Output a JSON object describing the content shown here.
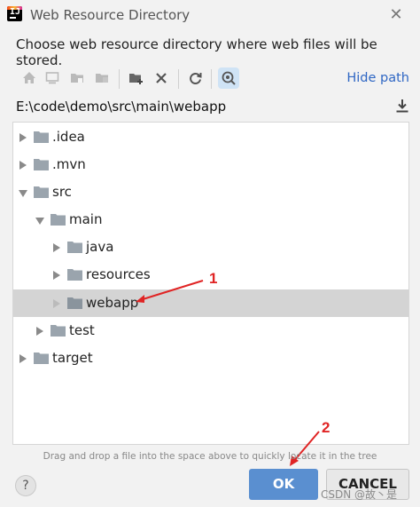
{
  "window": {
    "title": "Web Resource Directory",
    "app_icon": "intellij-idea-icon",
    "close_icon": "close-icon"
  },
  "prompt": "Choose web resource directory where web files will be stored.",
  "toolbar": {
    "buttons": [
      {
        "icon": "home-icon",
        "enabled": false
      },
      {
        "icon": "desktop-icon",
        "enabled": false
      },
      {
        "icon": "project-folder-icon",
        "enabled": false
      },
      {
        "icon": "module-folder-icon",
        "enabled": false
      },
      {
        "icon": "new-folder-icon",
        "enabled": true
      },
      {
        "icon": "delete-icon",
        "enabled": true
      },
      {
        "icon": "refresh-icon",
        "enabled": true
      },
      {
        "icon": "show-hidden-files-icon",
        "enabled": true,
        "active": true
      }
    ],
    "hide_path": "Hide path"
  },
  "path": {
    "value": "E:\\code\\demo\\src\\main\\webapp",
    "download_icon": "download-icon"
  },
  "tree": [
    {
      "label": ".idea",
      "expanded": false
    },
    {
      "label": ".mvn",
      "expanded": false
    },
    {
      "label": "src",
      "expanded": true
    },
    {
      "label": "main",
      "expanded": true
    },
    {
      "label": "java",
      "expanded": false
    },
    {
      "label": "resources",
      "expanded": false
    },
    {
      "label": "webapp",
      "expanded": false,
      "selected": true
    },
    {
      "label": "test",
      "expanded": false
    },
    {
      "label": "target",
      "expanded": false
    }
  ],
  "annotations": {
    "marker1": "1",
    "marker2": "2",
    "color": "#e02424"
  },
  "hint": "Drag and drop a file into the space above to quickly locate it in the tree",
  "buttons": {
    "help": "?",
    "ok": "OK",
    "cancel": "CANCEL"
  },
  "watermark": "CSDN @故丶是",
  "colors": {
    "ok_button": "#5a8fd0",
    "link": "#2f67c4",
    "selection": "#d4d4d4"
  }
}
